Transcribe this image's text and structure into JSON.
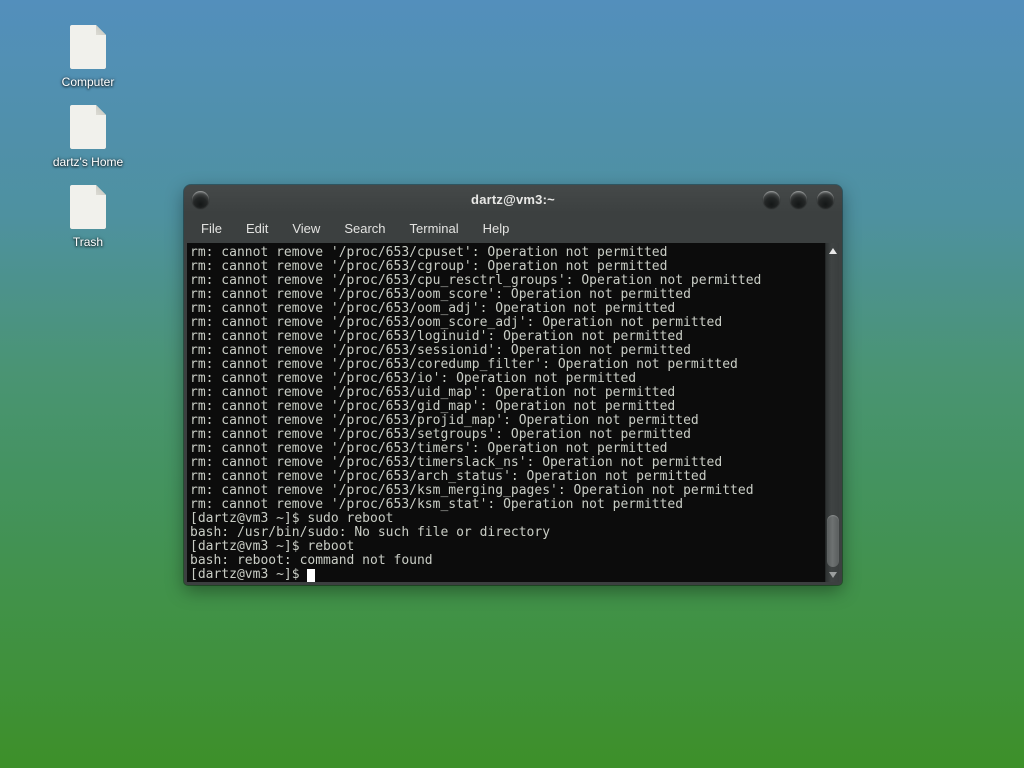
{
  "colors": {
    "desktop_gradient_top": "#538fbc",
    "desktop_gradient_mid": "#4a9474",
    "desktop_gradient_bottom": "#3d9029",
    "window_chrome": "#3c4040",
    "terminal_background": "#0c0c0c",
    "terminal_foreground": "#c9cdc5",
    "title_text": "#e8e8e6"
  },
  "desktop": {
    "icons": {
      "computer": "Computer",
      "home": "dartz's Home",
      "trash": "Trash"
    }
  },
  "window": {
    "title": "dartz@vm3:~",
    "menu": {
      "file": "File",
      "edit": "Edit",
      "view": "View",
      "search": "Search",
      "terminal": "Terminal",
      "help": "Help"
    },
    "terminal": {
      "lines": [
        "rm: cannot remove '/proc/653/cpuset': Operation not permitted",
        "rm: cannot remove '/proc/653/cgroup': Operation not permitted",
        "rm: cannot remove '/proc/653/cpu_resctrl_groups': Operation not permitted",
        "rm: cannot remove '/proc/653/oom_score': Operation not permitted",
        "rm: cannot remove '/proc/653/oom_adj': Operation not permitted",
        "rm: cannot remove '/proc/653/oom_score_adj': Operation not permitted",
        "rm: cannot remove '/proc/653/loginuid': Operation not permitted",
        "rm: cannot remove '/proc/653/sessionid': Operation not permitted",
        "rm: cannot remove '/proc/653/coredump_filter': Operation not permitted",
        "rm: cannot remove '/proc/653/io': Operation not permitted",
        "rm: cannot remove '/proc/653/uid_map': Operation not permitted",
        "rm: cannot remove '/proc/653/gid_map': Operation not permitted",
        "rm: cannot remove '/proc/653/projid_map': Operation not permitted",
        "rm: cannot remove '/proc/653/setgroups': Operation not permitted",
        "rm: cannot remove '/proc/653/timers': Operation not permitted",
        "rm: cannot remove '/proc/653/timerslack_ns': Operation not permitted",
        "rm: cannot remove '/proc/653/arch_status': Operation not permitted",
        "rm: cannot remove '/proc/653/ksm_merging_pages': Operation not permitted",
        "rm: cannot remove '/proc/653/ksm_stat': Operation not permitted",
        "[dartz@vm3 ~]$ sudo reboot",
        "bash: /usr/bin/sudo: No such file or directory",
        "[dartz@vm3 ~]$ reboot",
        "bash: reboot: command not found"
      ],
      "prompt": "[dartz@vm3 ~]$ "
    }
  }
}
